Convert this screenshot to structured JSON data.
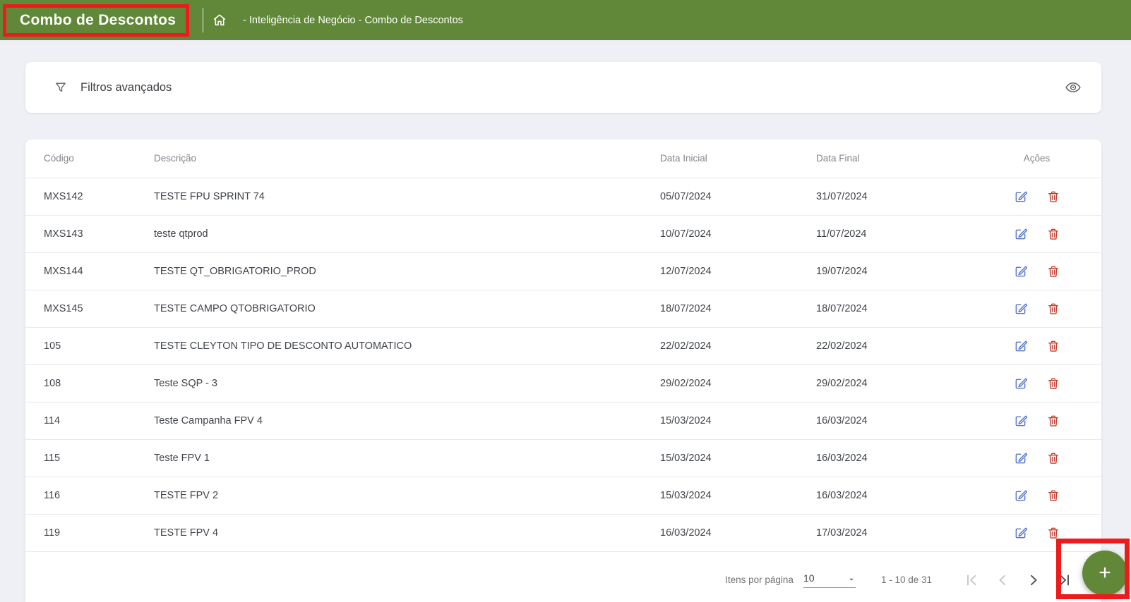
{
  "header": {
    "title": "Combo de Descontos",
    "breadcrumb": "- Inteligência de Negócio - Combo de Descontos"
  },
  "filters": {
    "label": "Filtros avançados"
  },
  "table": {
    "columns": [
      "Código",
      "Descrição",
      "Data Inicial",
      "Data Final",
      "Ações"
    ],
    "rows": [
      {
        "codigo": "MXS142",
        "descricao": "TESTE FPU SPRINT 74",
        "data_inicial": "05/07/2024",
        "data_final": "31/07/2024"
      },
      {
        "codigo": "MXS143",
        "descricao": "teste qtprod",
        "data_inicial": "10/07/2024",
        "data_final": "11/07/2024"
      },
      {
        "codigo": "MXS144",
        "descricao": "TESTE QT_OBRIGATORIO_PROD",
        "data_inicial": "12/07/2024",
        "data_final": "19/07/2024"
      },
      {
        "codigo": "MXS145",
        "descricao": "TESTE CAMPO QTOBRIGATORIO",
        "data_inicial": "18/07/2024",
        "data_final": "18/07/2024"
      },
      {
        "codigo": "105",
        "descricao": "TESTE CLEYTON TIPO DE DESCONTO AUTOMATICO",
        "data_inicial": "22/02/2024",
        "data_final": "22/02/2024"
      },
      {
        "codigo": "108",
        "descricao": "Teste SQP - 3",
        "data_inicial": "29/02/2024",
        "data_final": "29/02/2024"
      },
      {
        "codigo": "114",
        "descricao": "Teste Campanha FPV 4",
        "data_inicial": "15/03/2024",
        "data_final": "16/03/2024"
      },
      {
        "codigo": "115",
        "descricao": "Teste FPV 1",
        "data_inicial": "15/03/2024",
        "data_final": "16/03/2024"
      },
      {
        "codigo": "116",
        "descricao": "TESTE FPV 2",
        "data_inicial": "15/03/2024",
        "data_final": "16/03/2024"
      },
      {
        "codigo": "119",
        "descricao": "TESTE FPV 4",
        "data_inicial": "16/03/2024",
        "data_final": "17/03/2024"
      }
    ]
  },
  "pagination": {
    "items_per_page_label": "Itens por página",
    "items_per_page_value": "10",
    "range_label": "1 - 10 de 31"
  },
  "fab": {
    "label": "+"
  },
  "icons": {
    "home": "home-icon",
    "filter": "filter-funnel-icon",
    "eye": "visibility-icon",
    "edit": "edit-icon",
    "delete": "trash-icon"
  },
  "colors": {
    "green": "#618838",
    "annot_red": "#ee1b1b",
    "edit_blue": "#5472d3",
    "delete_red": "#c43d2d",
    "page_bg": "#eef0f5"
  }
}
